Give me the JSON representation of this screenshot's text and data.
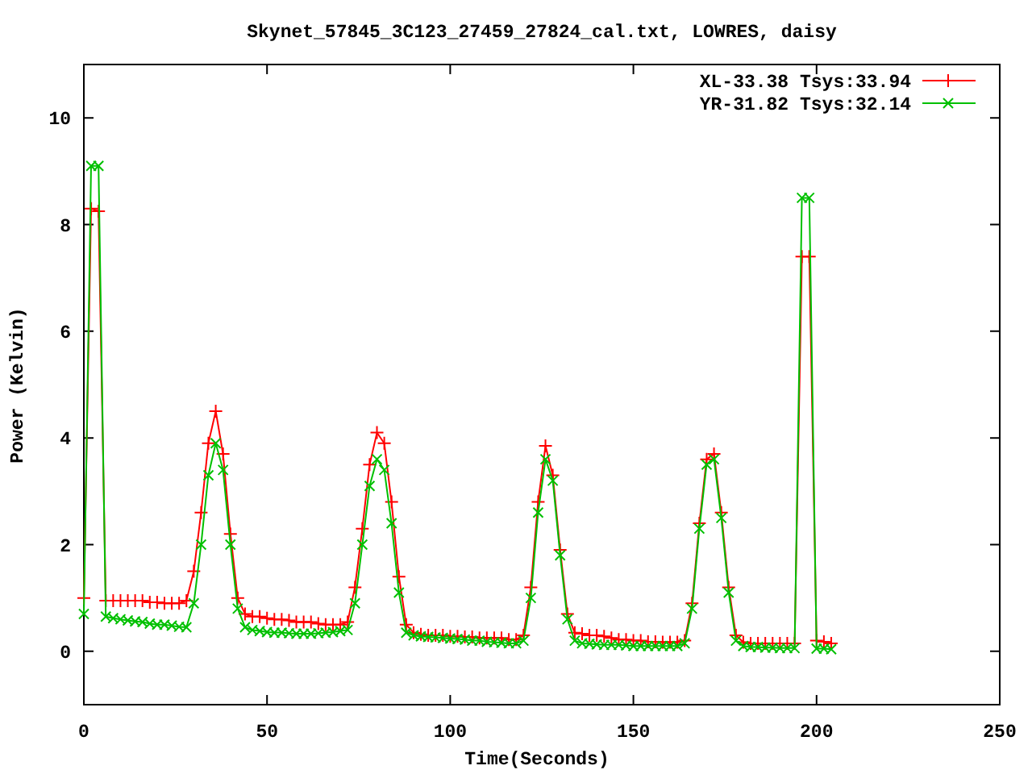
{
  "chart": {
    "chart_data": {
      "type": "line",
      "title": "Skynet_57845_3C123_27459_27824_cal.txt, LOWRES, daisy",
      "xlabel": "Time(Seconds)",
      "ylabel": "Power (Kelvin)",
      "xlim": [
        0,
        250
      ],
      "ylim": [
        -1,
        11
      ],
      "xticks": [
        0,
        50,
        100,
        150,
        200,
        250
      ],
      "yticks": [
        0,
        2,
        4,
        6,
        8,
        10
      ],
      "legend": true,
      "x": [
        0,
        2,
        4,
        6,
        8,
        10,
        12,
        14,
        16,
        18,
        20,
        22,
        24,
        26,
        28,
        30,
        32,
        34,
        36,
        38,
        40,
        42,
        44,
        46,
        48,
        50,
        52,
        54,
        56,
        58,
        60,
        62,
        64,
        66,
        68,
        70,
        72,
        74,
        76,
        78,
        80,
        82,
        84,
        86,
        88,
        90,
        92,
        94,
        96,
        98,
        100,
        102,
        104,
        106,
        108,
        110,
        112,
        114,
        116,
        118,
        120,
        122,
        124,
        126,
        128,
        130,
        132,
        134,
        136,
        138,
        140,
        142,
        144,
        146,
        148,
        150,
        152,
        154,
        156,
        158,
        160,
        162,
        164,
        166,
        168,
        170,
        172,
        174,
        176,
        178,
        180,
        182,
        184,
        186,
        188,
        190,
        192,
        194,
        196,
        198,
        200,
        202,
        204
      ],
      "series": [
        {
          "name": "XL-33.38 Tsys:33.94",
          "color": "#ff0000",
          "marker": "plus",
          "values": [
            1.0,
            8.3,
            8.25,
            0.95,
            0.95,
            0.95,
            0.95,
            0.95,
            0.95,
            0.92,
            0.92,
            0.9,
            0.9,
            0.9,
            0.95,
            1.5,
            2.6,
            3.9,
            4.5,
            3.7,
            2.2,
            1.0,
            0.7,
            0.65,
            0.65,
            0.62,
            0.6,
            0.6,
            0.58,
            0.55,
            0.55,
            0.55,
            0.52,
            0.5,
            0.5,
            0.5,
            0.55,
            1.2,
            2.3,
            3.5,
            4.1,
            3.9,
            2.8,
            1.4,
            0.5,
            0.35,
            0.32,
            0.3,
            0.3,
            0.3,
            0.28,
            0.28,
            0.27,
            0.27,
            0.25,
            0.25,
            0.25,
            0.25,
            0.22,
            0.22,
            0.3,
            1.2,
            2.8,
            3.85,
            3.3,
            1.9,
            0.7,
            0.35,
            0.33,
            0.3,
            0.3,
            0.28,
            0.25,
            0.22,
            0.22,
            0.2,
            0.2,
            0.18,
            0.18,
            0.17,
            0.17,
            0.17,
            0.2,
            0.9,
            2.4,
            3.6,
            3.7,
            2.6,
            1.2,
            0.3,
            0.17,
            0.15,
            0.15,
            0.15,
            0.15,
            0.15,
            0.15,
            0.15,
            7.4,
            7.4,
            0.2,
            0.18,
            0.15
          ]
        },
        {
          "name": "YR-31.82 Tsys:32.14",
          "color": "#00c000",
          "marker": "cross",
          "values": [
            0.7,
            9.1,
            9.1,
            0.65,
            0.62,
            0.6,
            0.58,
            0.56,
            0.55,
            0.52,
            0.5,
            0.5,
            0.48,
            0.46,
            0.45,
            0.9,
            2.0,
            3.3,
            3.9,
            3.4,
            2.0,
            0.8,
            0.45,
            0.4,
            0.38,
            0.36,
            0.35,
            0.35,
            0.34,
            0.33,
            0.33,
            0.33,
            0.34,
            0.35,
            0.36,
            0.38,
            0.4,
            0.9,
            2.0,
            3.1,
            3.6,
            3.4,
            2.4,
            1.1,
            0.35,
            0.3,
            0.28,
            0.27,
            0.26,
            0.25,
            0.24,
            0.23,
            0.22,
            0.2,
            0.2,
            0.18,
            0.17,
            0.16,
            0.15,
            0.15,
            0.2,
            1.0,
            2.6,
            3.6,
            3.2,
            1.8,
            0.6,
            0.2,
            0.15,
            0.14,
            0.13,
            0.12,
            0.12,
            0.12,
            0.11,
            0.1,
            0.1,
            0.1,
            0.1,
            0.1,
            0.1,
            0.1,
            0.15,
            0.8,
            2.3,
            3.5,
            3.6,
            2.5,
            1.1,
            0.2,
            0.1,
            0.08,
            0.08,
            0.07,
            0.07,
            0.06,
            0.06,
            0.06,
            8.5,
            8.5,
            0.05,
            0.05,
            0.04
          ]
        }
      ]
    }
  }
}
